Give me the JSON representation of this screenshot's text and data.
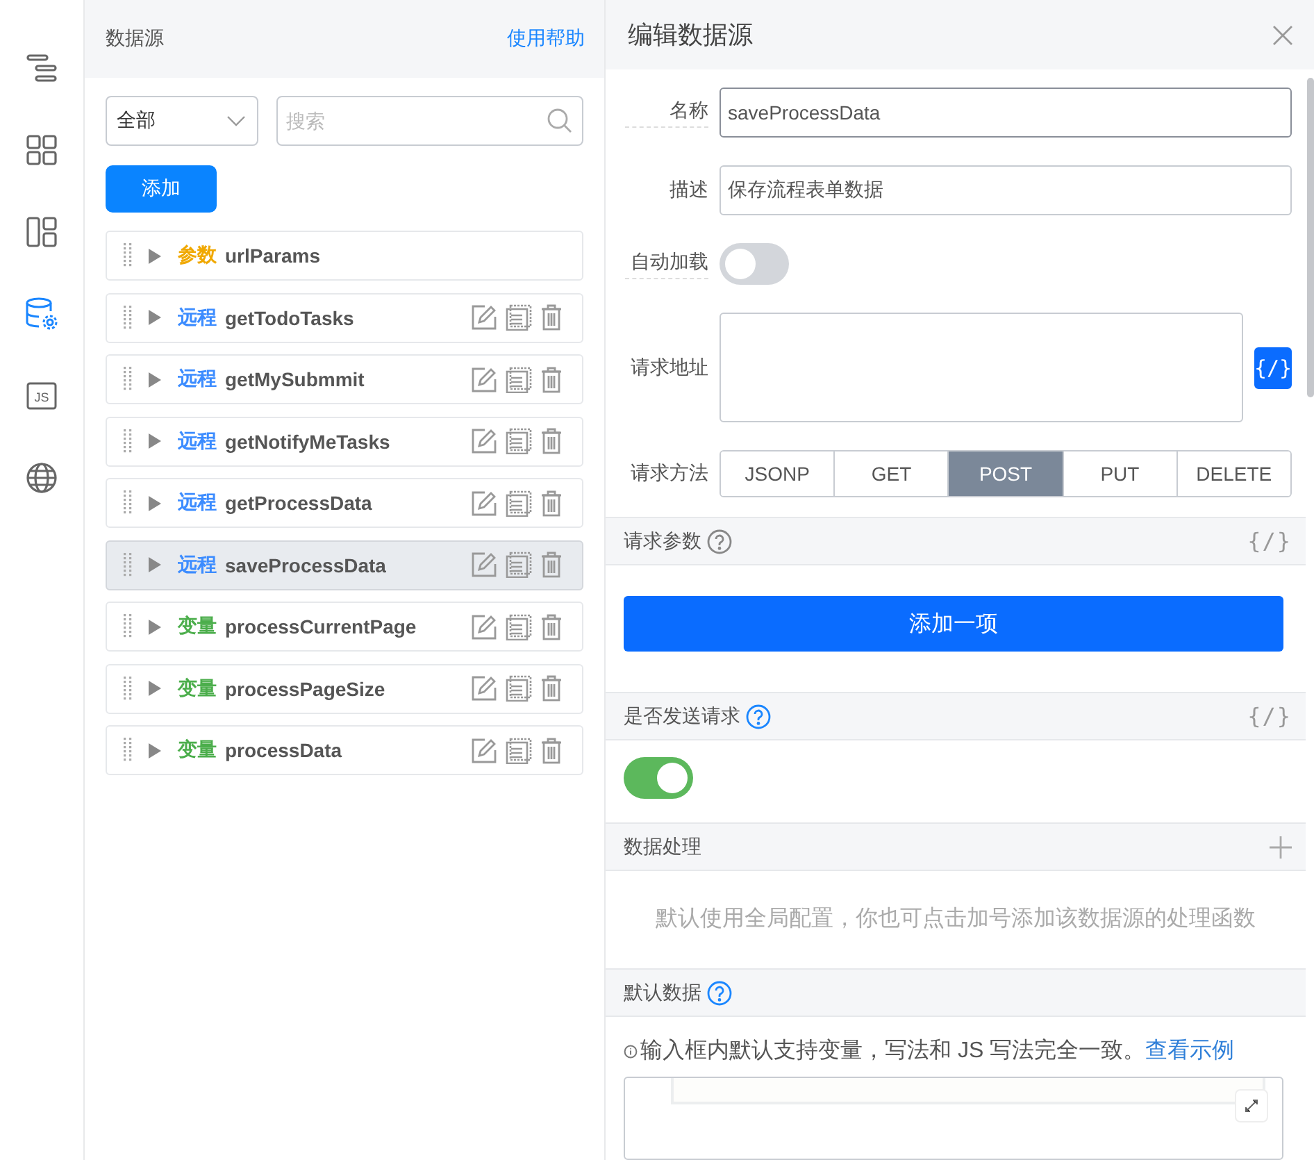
{
  "rail": [
    {
      "kind": "list",
      "selected": false
    },
    {
      "kind": "grid",
      "selected": false
    },
    {
      "kind": "layout",
      "selected": false
    },
    {
      "kind": "database",
      "selected": true
    },
    {
      "kind": "js",
      "selected": false,
      "label": "JS"
    },
    {
      "kind": "globe",
      "selected": false
    }
  ],
  "list_panel": {
    "title": "数据源",
    "help_link": "使用帮助",
    "filter": {
      "value": "全部"
    },
    "search": {
      "placeholder": "搜索"
    },
    "add_button": "添加",
    "items": [
      {
        "tag": "参数",
        "kind": "param",
        "name": "urlParams",
        "selected": false,
        "actions": false
      },
      {
        "tag": "远程",
        "kind": "remote",
        "name": "getTodoTasks",
        "selected": false,
        "actions": true
      },
      {
        "tag": "远程",
        "kind": "remote",
        "name": "getMySubmmit",
        "selected": false,
        "actions": true
      },
      {
        "tag": "远程",
        "kind": "remote",
        "name": "getNotifyMeTasks",
        "selected": false,
        "actions": true
      },
      {
        "tag": "远程",
        "kind": "remote",
        "name": "getProcessData",
        "selected": false,
        "actions": true
      },
      {
        "tag": "远程",
        "kind": "remote",
        "name": "saveProcessData",
        "selected": true,
        "actions": true
      },
      {
        "tag": "变量",
        "kind": "variable",
        "name": "processCurrentPage",
        "selected": false,
        "actions": true
      },
      {
        "tag": "变量",
        "kind": "variable",
        "name": "processPageSize",
        "selected": false,
        "actions": true
      },
      {
        "tag": "变量",
        "kind": "variable",
        "name": "processData",
        "selected": false,
        "actions": true
      }
    ]
  },
  "editor": {
    "title": "编辑数据源",
    "name_field": {
      "label": "名称",
      "value": "saveProcessData",
      "focused": true
    },
    "description_field": {
      "label": "描述",
      "value": "保存流程表单数据"
    },
    "auto_load": {
      "label": "自动加载",
      "on": false
    },
    "url_field": {
      "label": "请求地址",
      "code_button": "{/}"
    },
    "method": {
      "label": "请求方法",
      "options": [
        {
          "label": "JSONP",
          "selected": false
        },
        {
          "label": "GET",
          "selected": false
        },
        {
          "label": "POST",
          "selected": true
        },
        {
          "label": "PUT",
          "selected": false
        },
        {
          "label": "DELETE",
          "selected": false
        }
      ]
    },
    "sections": [
      {
        "kind": "params",
        "title": "请求参数",
        "help_highlighted": false,
        "code_toggle": "{/}",
        "add_button": "添加一项"
      },
      {
        "kind": "switch",
        "title": "是否发送请求",
        "help_highlighted": true,
        "code_toggle": "{/}",
        "on": true
      },
      {
        "kind": "handler",
        "title": "数据处理",
        "hint": "默认使用全局配置，你也可点击加号添加该数据源的处理函数"
      },
      {
        "kind": "default",
        "title": "默认数据",
        "help_highlighted": true,
        "info": "输入框内默认支持变量，写法和 JS 写法完全一致。",
        "link": "查看示例"
      }
    ]
  }
}
